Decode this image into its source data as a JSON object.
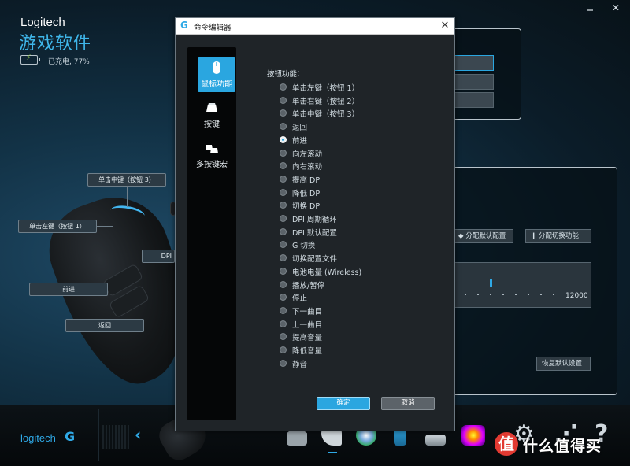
{
  "app": {
    "brand": "Logitech",
    "title": "游戏软件",
    "battery_status": "已充电, 77%",
    "battery_level": 0.77,
    "window_close": "✕"
  },
  "callouts": {
    "middle_click": "单击中键（按钮 3）",
    "left_click": "单击左键（按钮 1）",
    "forward": "前进",
    "back": "返回",
    "dpi": "DPI"
  },
  "right_panel": {
    "assign_default": "分配默认配置",
    "assign_switch": "分配切换功能",
    "dpi_max": "12000",
    "restore_defaults": "恢复默认设置"
  },
  "bottom_bar": {
    "logo_text": "logitech",
    "back_arrow": "‹",
    "help_glyph": "?"
  },
  "watermark": {
    "symbol": "值",
    "text": "什么值得买"
  },
  "dialog": {
    "title": "命令编辑器",
    "close": "✕",
    "nav": [
      {
        "label": "鼠标功能",
        "icon": "mouse-icon",
        "active": true
      },
      {
        "label": "按键",
        "icon": "key-icon",
        "active": false
      },
      {
        "label": "多按键宏",
        "icon": "multikey-icon",
        "active": false
      }
    ],
    "header": "按钮功能：",
    "options": [
      "单击左键（按钮 1）",
      "单击右键（按钮 2）",
      "单击中键（按钮 3）",
      "返回",
      "前进",
      "向左滚动",
      "向右滚动",
      "提高 DPI",
      "降低 DPI",
      "切换 DPI",
      "DPI 周期循环",
      "DPI 默认配置",
      "G 切换",
      "切换配置文件",
      "电池电量 (Wireless)",
      "播放/暂停",
      "停止",
      "下一曲目",
      "上一曲目",
      "提高音量",
      "降低音量",
      "静音"
    ],
    "selected_option": "前进",
    "ok": "确定",
    "cancel": "取消"
  },
  "colors": {
    "accent": "#2aa6e0",
    "title_blue": "#3fb6ea",
    "dialog_bg": "#1f2428"
  }
}
